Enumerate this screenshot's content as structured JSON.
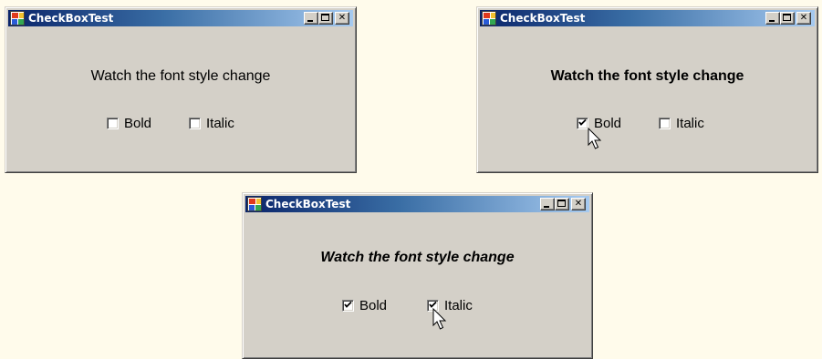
{
  "colors": {
    "background": "#fffbeb",
    "window": "#d4d0c8",
    "title_start": "#0a246a",
    "title_end": "#a6caf0"
  },
  "windows": [
    {
      "title": "CheckBoxTest",
      "label": "Watch the font style change",
      "bold": {
        "label": "Bold",
        "checked": false
      },
      "italic": {
        "label": "Italic",
        "checked": false
      }
    },
    {
      "title": "CheckBoxTest",
      "label": "Watch the font style change",
      "bold": {
        "label": "Bold",
        "checked": true
      },
      "italic": {
        "label": "Italic",
        "checked": false
      }
    },
    {
      "title": "CheckBoxTest",
      "label": "Watch the font style change",
      "bold": {
        "label": "Bold",
        "checked": true
      },
      "italic": {
        "label": "Italic",
        "checked": true
      }
    }
  ],
  "icons": {
    "app": "app-icon",
    "minimize": "minimize-icon",
    "maximize": "maximize-icon",
    "close": "close-icon",
    "check": "checkmark-icon",
    "cursor": "mouse-pointer-icon"
  }
}
